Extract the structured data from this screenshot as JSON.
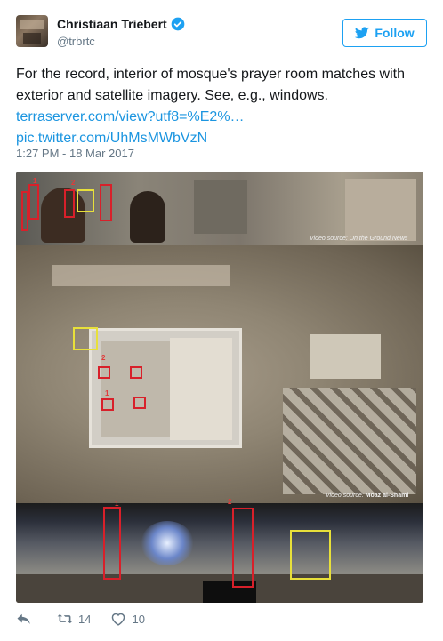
{
  "author": {
    "display_name": "Christiaan Triebert",
    "handle": "@trbrtc",
    "verified_icon": "verified-badge-icon"
  },
  "follow_button": {
    "label": "Follow"
  },
  "tweet": {
    "text": "For the record, interior of mosque's prayer room matches with exterior and satellite imagery. See, e.g., windows.",
    "link1": "terraserver.com/view?utf8=%E2%…",
    "link2": "pic.twitter.com/UhMsMWbVzN",
    "timestamp": "1:27 PM - 18 Mar 2017"
  },
  "media": {
    "caption_top": "Video source: On the Ground News",
    "caption_mid_prefix": "Video source:",
    "caption_mid_name": "Moaz al-Shami",
    "marker_labels": [
      "1",
      "2",
      "2",
      "1",
      "1",
      "2"
    ]
  },
  "actions": {
    "reply_icon": "reply-icon",
    "retweet_icon": "retweet-icon",
    "retweet_count": "14",
    "like_icon": "heart-icon",
    "like_count": "10"
  },
  "colors": {
    "link": "#1b95e0",
    "follow": "#1da1f2",
    "muted": "#657786",
    "marker_red": "#d8202a",
    "marker_yellow": "#e8e03a"
  }
}
